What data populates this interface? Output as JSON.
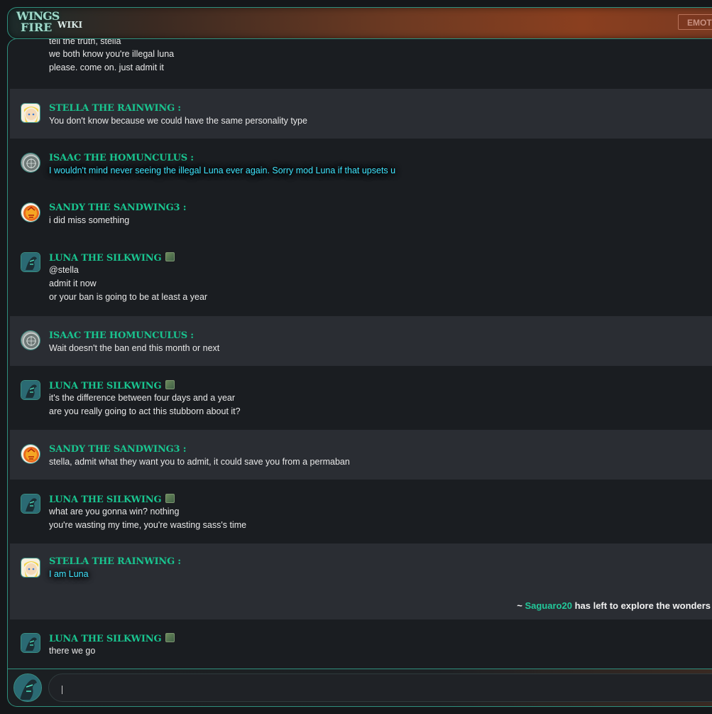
{
  "header": {
    "logo_line1": "WINGS",
    "logo_line2": "FIRE",
    "logo_wiki": "WIKI",
    "emote_button": "EMOT"
  },
  "messages": [
    {
      "lines": [
        "tell the truth, stella",
        "we both know you're illegal luna",
        "please. come on. just admit it"
      ]
    },
    {
      "name": "STELLA THE RAINWING :",
      "avatar": "stella-avatar",
      "lines": [
        "You don't know because we could have the same personality type"
      ]
    },
    {
      "name": "ISAAC THE HOMUNCULUS :",
      "avatar": "isaac-avatar",
      "lines": [
        "I wouldn't mind never seeing the illegal Luna ever again. Sorry mod Luna if that upsets u"
      ]
    },
    {
      "name": "SANDY THE SANDWING3 :",
      "avatar": "sandy-avatar",
      "lines": [
        "i did miss something"
      ]
    },
    {
      "name": "LUNA THE SILKWING",
      "avatar": "luna-avatar",
      "lines": [
        "@stella",
        "admit it now",
        "or your ban is going to be at least a year"
      ]
    },
    {
      "name": "ISAAC THE HOMUNCULUS :",
      "avatar": "isaac-avatar",
      "lines": [
        "Wait doesn't the ban end this month or next"
      ]
    },
    {
      "name": "LUNA THE SILKWING",
      "avatar": "luna-avatar",
      "lines": [
        "it's the difference between four days and a year",
        "are you really going to act this stubborn about it?"
      ]
    },
    {
      "name": "SANDY THE SANDWING3 :",
      "avatar": "sandy-avatar",
      "lines": [
        "stella, admit what they want you to admit, it could save you from a permaban"
      ]
    },
    {
      "name": "LUNA THE SILKWING",
      "avatar": "luna-avatar",
      "lines": [
        "what are you gonna win? nothing",
        "you're wasting my time, you're wasting sass's time"
      ]
    },
    {
      "name": "STELLA THE RAINWING :",
      "avatar": "stella-avatar",
      "lines": [
        "I am Luna"
      ]
    },
    {
      "name": "LUNA THE SILKWING",
      "avatar": "luna-avatar",
      "lines": [
        "there we go"
      ]
    }
  ],
  "system_message": {
    "prefix": "~ ",
    "user": "Saguaro20",
    "text": " has left to explore the wonders"
  },
  "input": {
    "value": "",
    "placeholder": ""
  },
  "colors": {
    "accent": "#19c48f",
    "glow_text": "#3fe6ff",
    "border": "#2f8f7d"
  }
}
